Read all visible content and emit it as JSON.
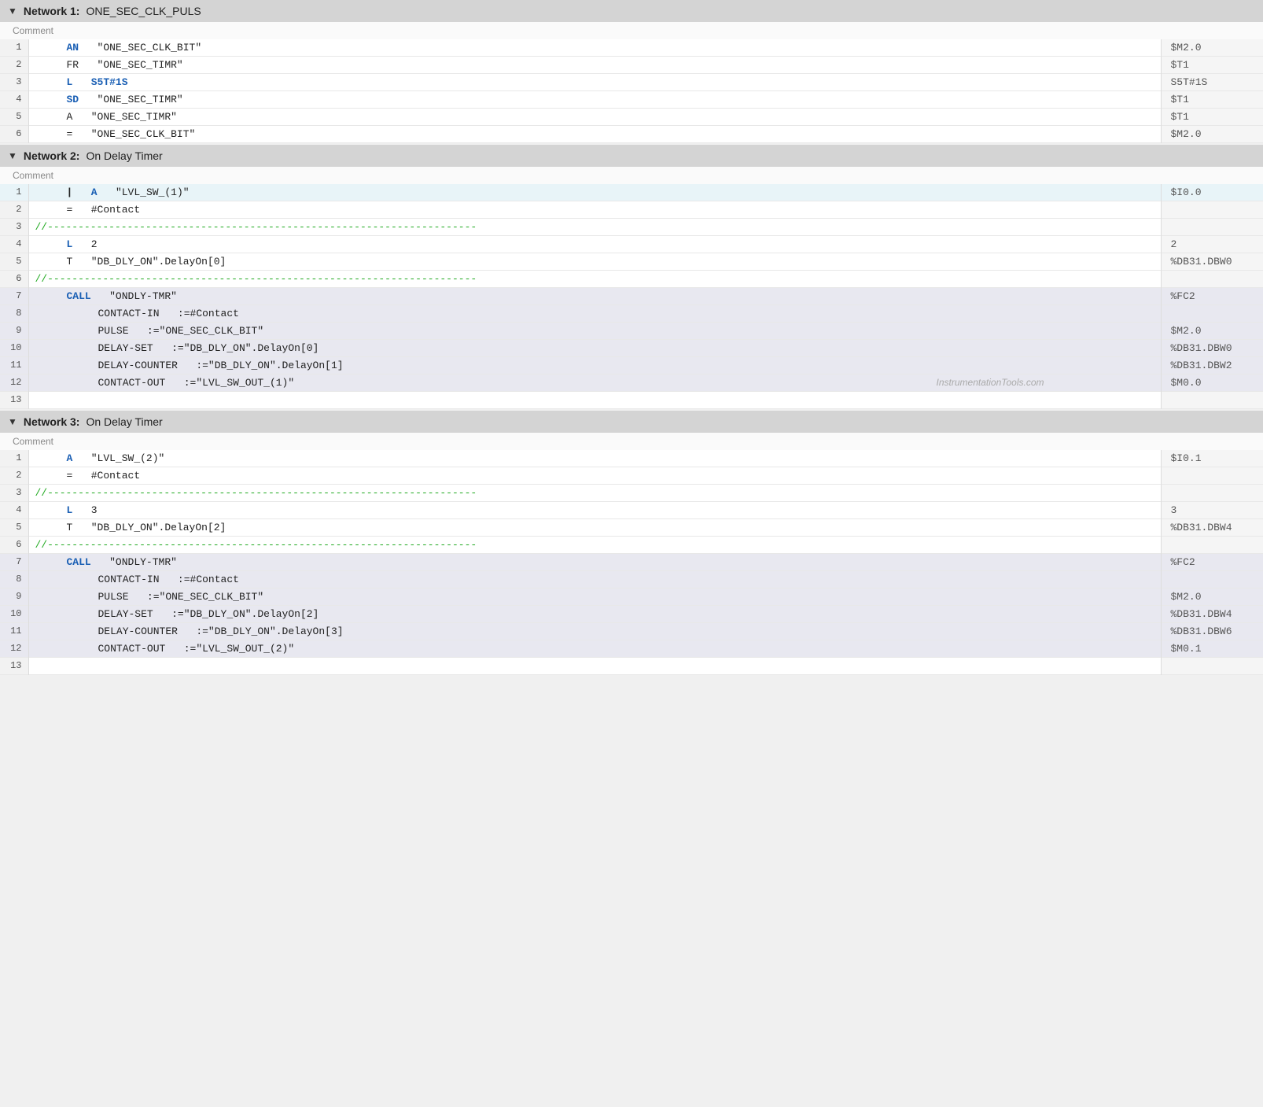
{
  "networks": [
    {
      "id": "n1",
      "label": "Network 1:",
      "name": "ONE_SEC_CLK_PULS",
      "comment": "Comment",
      "rows": [
        {
          "num": 1,
          "indent": 3,
          "kw": "AN",
          "kwClass": "kw-blue",
          "arg": "\"ONE_SEC_CLK_BIT\"",
          "right": "$M2.0",
          "type": "normal"
        },
        {
          "num": 2,
          "indent": 3,
          "kw": "FR",
          "kwClass": "",
          "arg": "\"ONE_SEC_TIMR\"",
          "right": "$T1",
          "type": "normal"
        },
        {
          "num": 3,
          "indent": 3,
          "kw": "L",
          "kwClass": "kw-blue",
          "arg": "S5T#1S",
          "argClass": "kw-blue",
          "right": "S5T#1S",
          "type": "normal"
        },
        {
          "num": 4,
          "indent": 3,
          "kw": "SD",
          "kwClass": "kw-blue",
          "arg": "\"ONE_SEC_TIMR\"",
          "right": "$T1",
          "type": "normal"
        },
        {
          "num": 5,
          "indent": 3,
          "kw": "A",
          "kwClass": "",
          "arg": "\"ONE_SEC_TIMR\"",
          "right": "$T1",
          "type": "normal"
        },
        {
          "num": 6,
          "indent": 3,
          "kw": "=",
          "kwClass": "",
          "arg": "\"ONE_SEC_CLK_BIT\"",
          "right": "$M2.0",
          "type": "normal"
        }
      ]
    },
    {
      "id": "n2",
      "label": "Network 2:",
      "name": "On Delay Timer",
      "comment": "Comment",
      "rows": [
        {
          "num": 1,
          "indent": 3,
          "kw": "A",
          "kwClass": "kw-blue",
          "arg": "\"LVL_SW_(1)\"",
          "right": "$I0.0",
          "type": "highlighted",
          "pipe": true
        },
        {
          "num": 2,
          "indent": 3,
          "kw": "=",
          "kwClass": "",
          "arg": "#Contact",
          "right": "",
          "type": "normal"
        },
        {
          "num": 3,
          "indent": 0,
          "kw": "//---",
          "kwClass": "comment-dashed",
          "arg": "----------------------------------------------------------------------",
          "right": "",
          "type": "normal"
        },
        {
          "num": 4,
          "indent": 3,
          "kw": "L",
          "kwClass": "kw-blue",
          "arg": "2",
          "right": "2",
          "type": "normal"
        },
        {
          "num": 5,
          "indent": 3,
          "kw": "T",
          "kwClass": "",
          "arg": "\"DB_DLY_ON\".DelayOn[0]",
          "right": "%DB31.DBW0",
          "type": "normal"
        },
        {
          "num": 6,
          "indent": 0,
          "kw": "//---",
          "kwClass": "comment-dashed",
          "arg": "----------------------------------------------------------------------",
          "right": "",
          "type": "normal"
        },
        {
          "num": 7,
          "indent": 3,
          "kw": "CALL",
          "kwClass": "kw-call",
          "arg": "\"ONDLY-TMR\"",
          "right": "%FC2",
          "type": "call-head"
        },
        {
          "num": 8,
          "indent": 5,
          "kw": "CONTACT-IN",
          "kwClass": "",
          "arg": ":=#Contact",
          "right": "",
          "type": "call-body"
        },
        {
          "num": 9,
          "indent": 5,
          "kw": "PULSE",
          "kwClass": "",
          "arg": ":=\"ONE_SEC_CLK_BIT\"",
          "right": "$M2.0",
          "type": "call-body"
        },
        {
          "num": 10,
          "indent": 5,
          "kw": "DELAY-SET",
          "kwClass": "",
          "arg": ":=\"DB_DLY_ON\".DelayOn[0]",
          "right": "%DB31.DBW0",
          "type": "call-body"
        },
        {
          "num": 11,
          "indent": 5,
          "kw": "DELAY-COUNTER",
          "kwClass": "",
          "arg": ":=\"DB_DLY_ON\".DelayOn[1]",
          "right": "%DB31.DBW2",
          "type": "call-body"
        },
        {
          "num": 12,
          "indent": 5,
          "kw": "CONTACT-OUT",
          "kwClass": "",
          "arg": ":=\"LVL_SW_OUT_(1)\"",
          "right": "$M0.0",
          "type": "call-body",
          "watermark": "InstrumentationTools.com"
        },
        {
          "num": 13,
          "indent": 0,
          "kw": "",
          "kwClass": "",
          "arg": "",
          "right": "",
          "type": "normal"
        }
      ]
    },
    {
      "id": "n3",
      "label": "Network 3:",
      "name": "On Delay Timer",
      "comment": "Comment",
      "rows": [
        {
          "num": 1,
          "indent": 3,
          "kw": "A",
          "kwClass": "kw-blue",
          "arg": "\"LVL_SW_(2)\"",
          "right": "$I0.1",
          "type": "normal"
        },
        {
          "num": 2,
          "indent": 3,
          "kw": "=",
          "kwClass": "",
          "arg": "#Contact",
          "right": "",
          "type": "normal"
        },
        {
          "num": 3,
          "indent": 0,
          "kw": "//---",
          "kwClass": "comment-dashed",
          "arg": "----------------------------------------------------------------------",
          "right": "",
          "type": "normal"
        },
        {
          "num": 4,
          "indent": 3,
          "kw": "L",
          "kwClass": "kw-blue",
          "arg": "3",
          "right": "3",
          "type": "normal"
        },
        {
          "num": 5,
          "indent": 3,
          "kw": "T",
          "kwClass": "",
          "arg": "\"DB_DLY_ON\".DelayOn[2]",
          "right": "%DB31.DBW4",
          "type": "normal"
        },
        {
          "num": 6,
          "indent": 0,
          "kw": "//---",
          "kwClass": "comment-dashed",
          "arg": "----------------------------------------------------------------------",
          "right": "",
          "type": "normal"
        },
        {
          "num": 7,
          "indent": 3,
          "kw": "CALL",
          "kwClass": "kw-call",
          "arg": "\"ONDLY-TMR\"",
          "right": "%FC2",
          "type": "call-head"
        },
        {
          "num": 8,
          "indent": 5,
          "kw": "CONTACT-IN",
          "kwClass": "",
          "arg": ":=#Contact",
          "right": "",
          "type": "call-body"
        },
        {
          "num": 9,
          "indent": 5,
          "kw": "PULSE",
          "kwClass": "",
          "arg": ":=\"ONE_SEC_CLK_BIT\"",
          "right": "$M2.0",
          "type": "call-body"
        },
        {
          "num": 10,
          "indent": 5,
          "kw": "DELAY-SET",
          "kwClass": "",
          "arg": ":=\"DB_DLY_ON\".DelayOn[2]",
          "right": "%DB31.DBW4",
          "type": "call-body"
        },
        {
          "num": 11,
          "indent": 5,
          "kw": "DELAY-COUNTER",
          "kwClass": "",
          "arg": ":=\"DB_DLY_ON\".DelayOn[3]",
          "right": "%DB31.DBW6",
          "type": "call-body"
        },
        {
          "num": 12,
          "indent": 5,
          "kw": "CONTACT-OUT",
          "kwClass": "",
          "arg": ":=\"LVL_SW_OUT_(2)\"",
          "right": "$M0.1",
          "type": "call-body"
        },
        {
          "num": 13,
          "indent": 0,
          "kw": "",
          "kwClass": "",
          "arg": "",
          "right": "",
          "type": "normal"
        }
      ]
    }
  ]
}
